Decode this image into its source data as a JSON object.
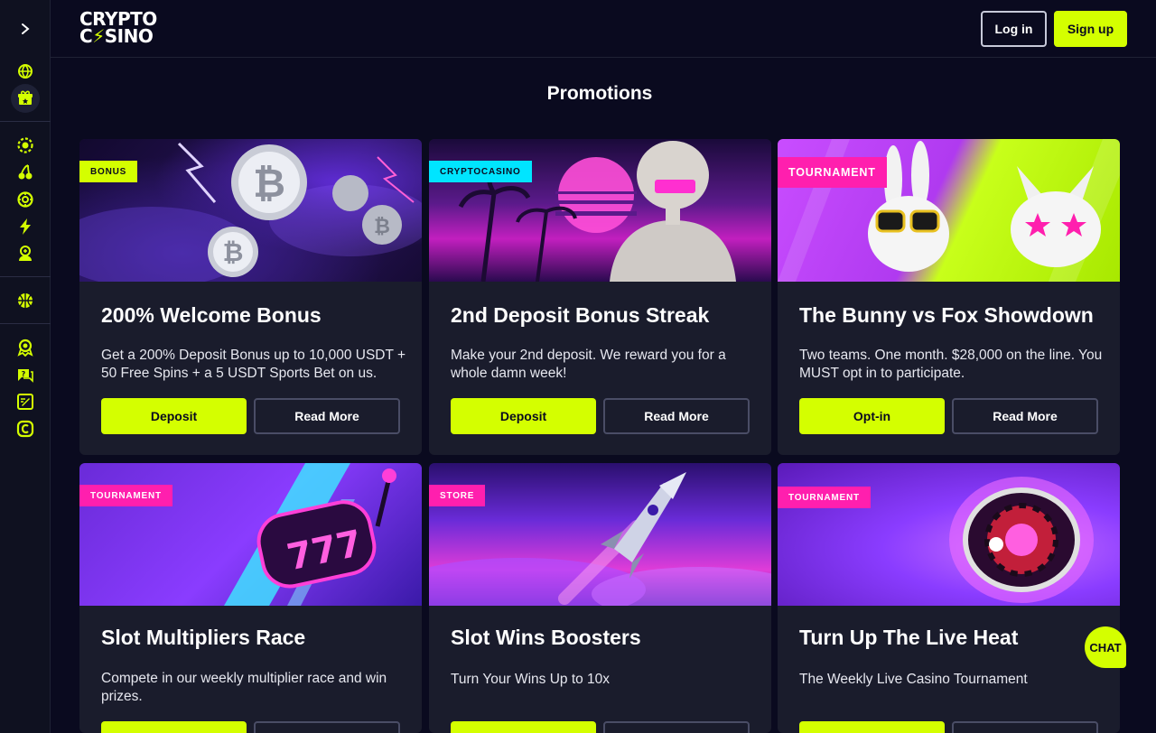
{
  "colors": {
    "accent": "#d4ff00",
    "background": "#0a0a1f",
    "card": "#1a1c2c",
    "tag_pink": "#ff1fae",
    "tag_cyan": "#00e5ff"
  },
  "sidebar": {
    "toggle_icon": "chevron-right-icon",
    "items": [
      {
        "icon": "globe-icon"
      },
      {
        "icon": "gift-icon",
        "active": true
      },
      {
        "icon": "casino-chip-icon"
      },
      {
        "icon": "cherries-icon"
      },
      {
        "icon": "roulette-icon"
      },
      {
        "icon": "lightning-icon"
      },
      {
        "icon": "dealer-icon"
      },
      {
        "icon": "basketball-icon"
      },
      {
        "icon": "vip-icon"
      },
      {
        "icon": "support-icon"
      },
      {
        "icon": "blog-icon"
      },
      {
        "icon": "coin-icon"
      }
    ]
  },
  "header": {
    "logo_line1": "CRYPTO",
    "logo_line2_a": "C",
    "logo_line2_b": "SINO",
    "login_label": "Log in",
    "signup_label": "Sign up"
  },
  "page": {
    "title": "Promotions"
  },
  "cards": [
    {
      "tag": "BONUS",
      "tag_style": "accent",
      "title": "200% Welcome Bonus",
      "description": "Get a 200% Deposit Bonus up to 10,000 USDT + 50 Free Spins + a 5 USDT Sports Bet on us.",
      "primary": "Deposit",
      "secondary": "Read More"
    },
    {
      "tag": "CRYPTOCASINO",
      "tag_style": "cyan",
      "title": "2nd Deposit Bonus Streak",
      "description": "Make your 2nd deposit. We reward you for a whole damn week!",
      "primary": "Deposit",
      "secondary": "Read More"
    },
    {
      "tag": "TOURNAMENT",
      "tag_style": "pink",
      "title": "The Bunny vs Fox Showdown",
      "description": "Two teams. One month. $28,000 on the line. You MUST opt in to participate.",
      "primary": "Opt-in",
      "secondary": "Read More"
    },
    {
      "tag": "TOURNAMENT",
      "tag_style": "pink",
      "title": "Slot Multipliers Race",
      "description": "Compete in our weekly multiplier race and win prizes."
    },
    {
      "tag": "STORE",
      "tag_style": "pink",
      "title": "Slot Wins Boosters",
      "description": "Turn Your Wins Up to 10x"
    },
    {
      "tag": "TOURNAMENT",
      "tag_style": "pink",
      "title": "Turn Up The Live Heat",
      "description": "The Weekly Live Casino Tournament"
    }
  ],
  "chat": {
    "label": "CHAT"
  }
}
